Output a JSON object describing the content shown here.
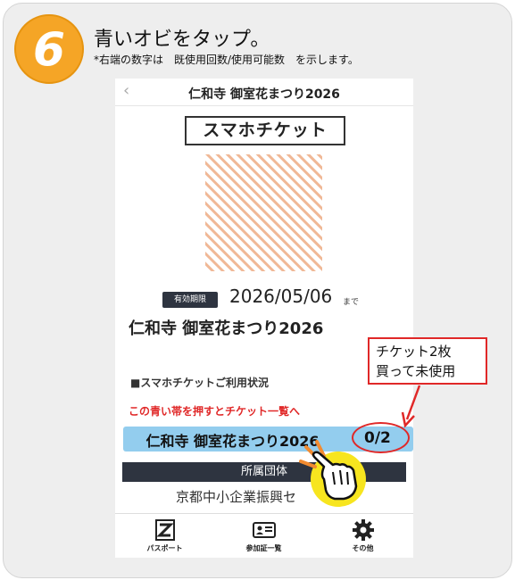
{
  "step": {
    "number": "6",
    "title": "青いオビをタップ。",
    "note": "*右端の数字は　既使用回数/使用可能数　を示します。",
    "badge_color": "#f5a526"
  },
  "phone": {
    "nav": {
      "back_icon": "chevron-left-icon",
      "title": "仁和寺 御室花まつり2026"
    },
    "ticket_title": "スマホチケット",
    "expiry": {
      "badge": "有効期限",
      "date": "2026/05/06",
      "suffix": "まで"
    },
    "event_name": "仁和寺 御室花まつり2026",
    "usage_heading": "■スマホチケットご利用状況",
    "hint": "この青い帯を押すとチケット一覧へ",
    "event_bar": {
      "label": "仁和寺 御室花まつり2026",
      "count": "0/2",
      "color": "#93cdee"
    },
    "group": {
      "header": "所属団体",
      "name": "京都中小企業振興セ"
    },
    "tabs": [
      {
        "label": "パスポート",
        "icon": "passport-z-icon"
      },
      {
        "label": "参加証一覧",
        "icon": "id-card-icon"
      },
      {
        "label": "その他",
        "icon": "gear-icon"
      }
    ]
  },
  "callout": {
    "lines": [
      "チケット2枚",
      "買って未使用"
    ],
    "color": "#e02828"
  }
}
